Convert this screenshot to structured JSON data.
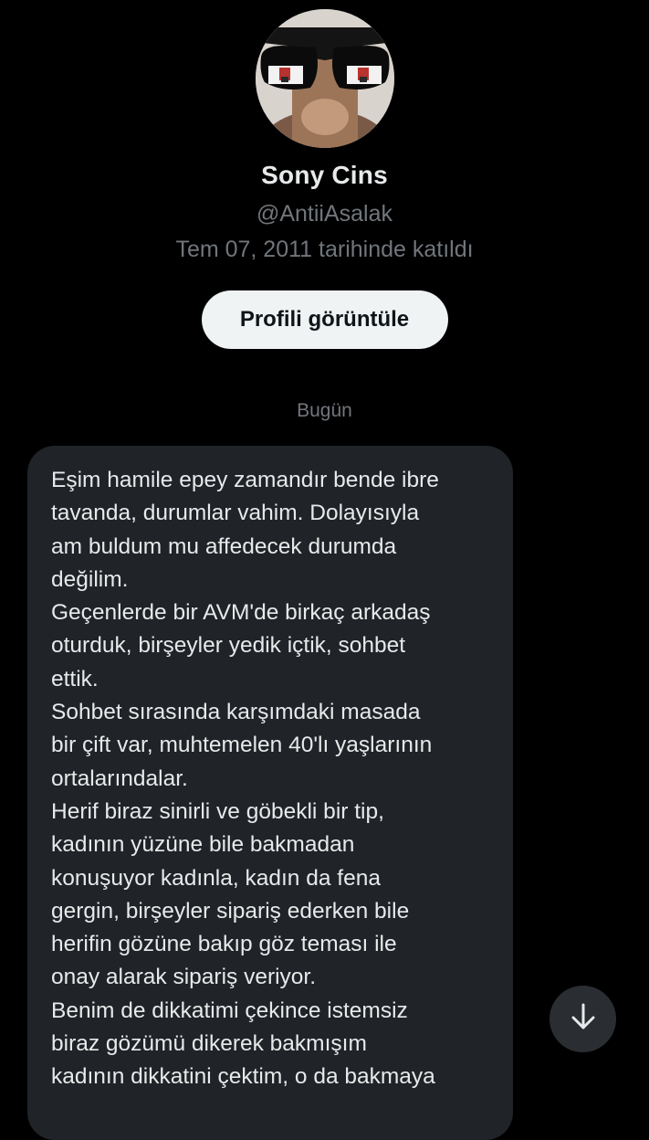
{
  "profile": {
    "name": "Sony Cins",
    "handle": "@AntiiAsalak",
    "joined": "Tem 07, 2011 tarihinde katıldı",
    "view_profile_label": "Profili görüntüle"
  },
  "chat": {
    "date_separator": "Bugün",
    "message_lines": [
      "Eşim hamile epey zamandır bende ibre",
      "tavanda, durumlar vahim. Dolayısıyla",
      "am buldum mu affedecek durumda",
      "değilim.",
      "Geçenlerde bir AVM'de birkaç arkadaş",
      "oturduk, birşeyler yedik içtik, sohbet",
      "ettik.",
      "Sohbet sırasında karşımdaki masada",
      "bir çift var, muhtemelen 40'lı yaşlarının",
      "ortalarındalar.",
      "Herif biraz sinirli ve göbekli bir tip,",
      "kadının yüzüne bile bakmadan",
      "konuşuyor kadınla, kadın da fena",
      "gergin, birşeyler sipariş ederken bile",
      "herifin gözüne bakıp göz teması ile",
      "onay alarak sipariş veriyor.",
      "Benim de dikkatimi çekince istemsiz",
      "biraz gözümü dikerek bakmışım",
      "kadının dikkatini çektim, o da bakmaya"
    ]
  },
  "icons": {
    "scroll_down": "arrow-down-icon"
  },
  "colors": {
    "background": "#000000",
    "bubble": "#202327",
    "primary_text": "#e7e9ea",
    "secondary_text": "#71767b",
    "button_bg": "#eff3f4",
    "button_text": "#0f1419"
  }
}
